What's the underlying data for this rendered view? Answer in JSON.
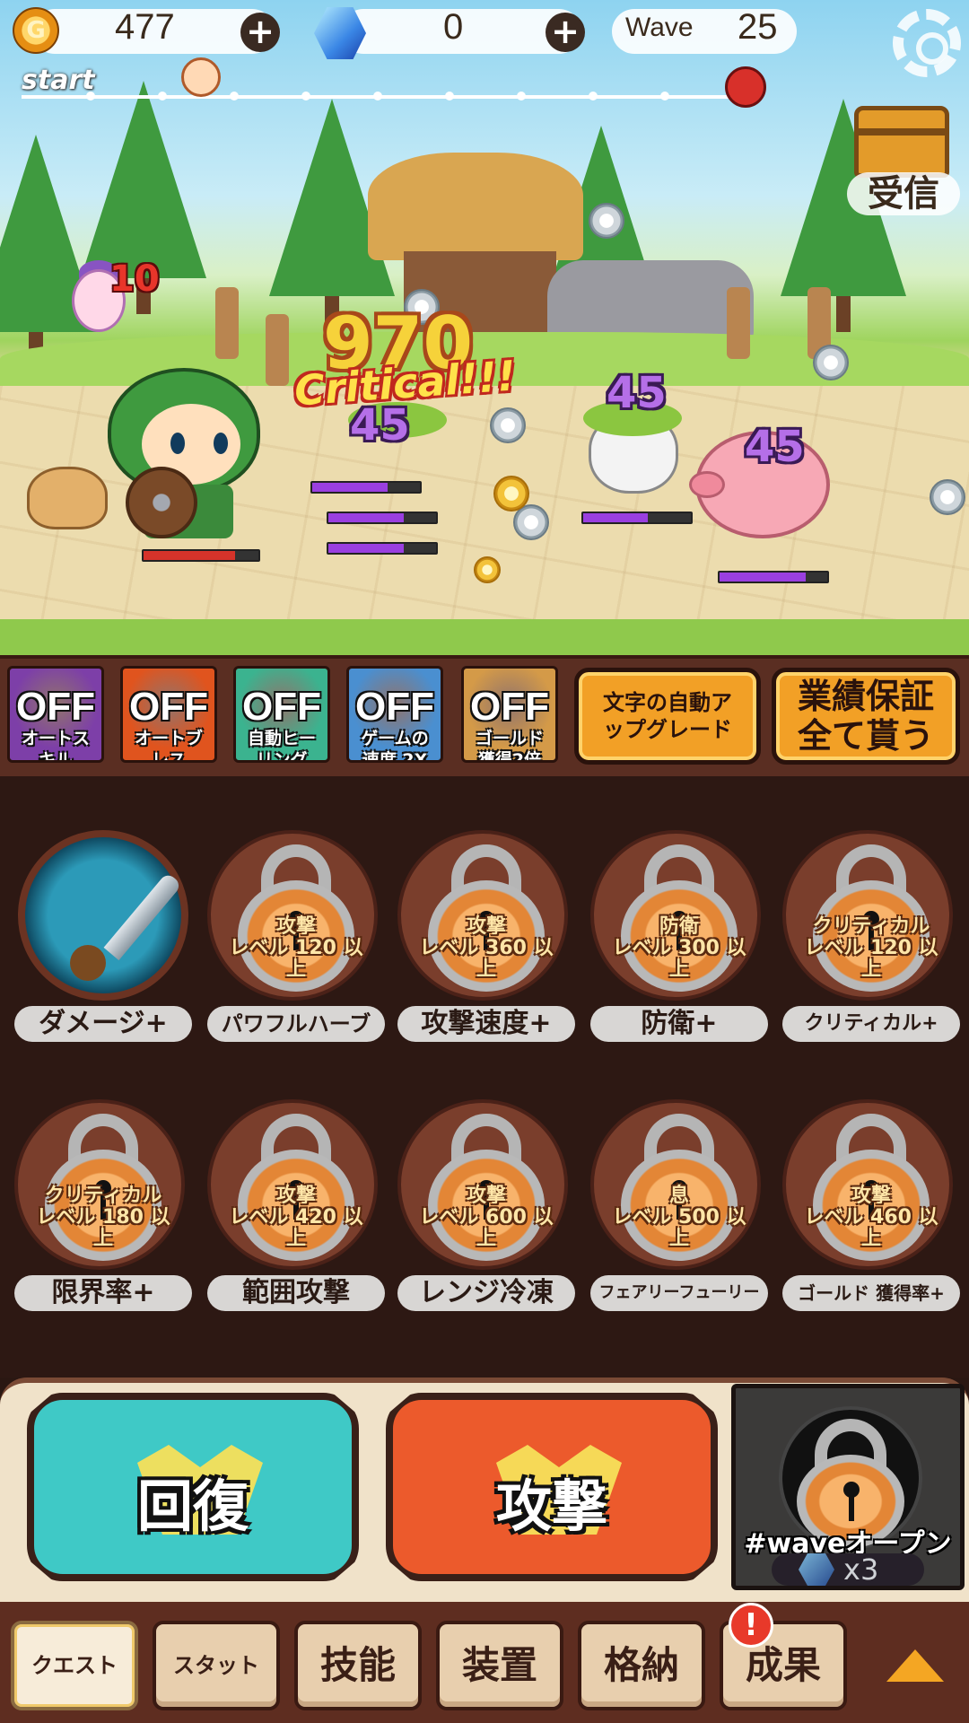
{
  "hud": {
    "gold": "477",
    "gold_icon": "G",
    "gems": "0",
    "plus": "+",
    "wave_label": "Wave",
    "wave_number": "25",
    "progress_start": "start",
    "reward_label": "受信"
  },
  "battle": {
    "critical_damage": "970",
    "critical_text": "Critical!!!",
    "fairy_damage": "10",
    "enemy_damage": [
      "45",
      "45",
      "45"
    ],
    "hero_hp": 0.8,
    "enemy_hp": [
      0.7,
      0.7,
      0.7,
      0.6,
      0.8
    ]
  },
  "toggles": [
    {
      "state": "OFF",
      "caption": "オートス\nキル",
      "color": "#7d3fa8"
    },
    {
      "state": "OFF",
      "caption": "オートブ\nレス",
      "color": "#e0541e"
    },
    {
      "state": "OFF",
      "caption": "自動ヒー\nリング",
      "color": "#3bb38f"
    },
    {
      "state": "OFF",
      "caption": "ゲームの\n速度 2X",
      "color": "#4a8fd0"
    },
    {
      "state": "OFF",
      "caption": "ゴールド\n獲得2倍",
      "color": "#d49a48"
    }
  ],
  "action_buttons": {
    "auto_upgrade": "文字の自動ア\nップグレード",
    "claim_all": "業績保証\n全て貰う"
  },
  "skills": [
    {
      "label": "ダメージ+",
      "locked": false,
      "req": ""
    },
    {
      "label": "パワフルハーブ",
      "locked": true,
      "req": "攻撃\nレベル 120 以\n上"
    },
    {
      "label": "攻撃速度+",
      "locked": true,
      "req": "攻撃\nレベル 360 以\n上"
    },
    {
      "label": "防衛+",
      "locked": true,
      "req": "防衛\nレベル 300 以\n上"
    },
    {
      "label": "クリティカル+",
      "locked": true,
      "req": "クリティカル\nレベル 120 以\n上"
    },
    {
      "label": "限界率+",
      "locked": true,
      "req": "クリティカル\nレベル 180 以\n上"
    },
    {
      "label": "範囲攻撃",
      "locked": true,
      "req": "攻撃\nレベル 420 以\n上"
    },
    {
      "label": "レンジ冷凍",
      "locked": true,
      "req": "攻撃\nレベル 600 以\n上"
    },
    {
      "label": "フェアリーフューリー",
      "locked": true,
      "req": "息\nレベル 500 以\n上"
    },
    {
      "label": "ゴールド 獲得率+",
      "locked": true,
      "req": "攻撃\nレベル 460 以\n上"
    }
  ],
  "main_actions": {
    "heal": "回復",
    "attack": "攻撃",
    "wave_open": "#waveオープン",
    "wave_cost": "x3"
  },
  "nav": {
    "tabs": [
      "クエスト",
      "スタット",
      "技能",
      "装置",
      "格納",
      "成果"
    ],
    "active": 0,
    "alert": "!"
  },
  "colors": {
    "heal_button": "#3fc9c6",
    "attack_button": "#ec5a2c",
    "hp_red": "#d6332a",
    "hp_purple": "#9a3fe0"
  }
}
